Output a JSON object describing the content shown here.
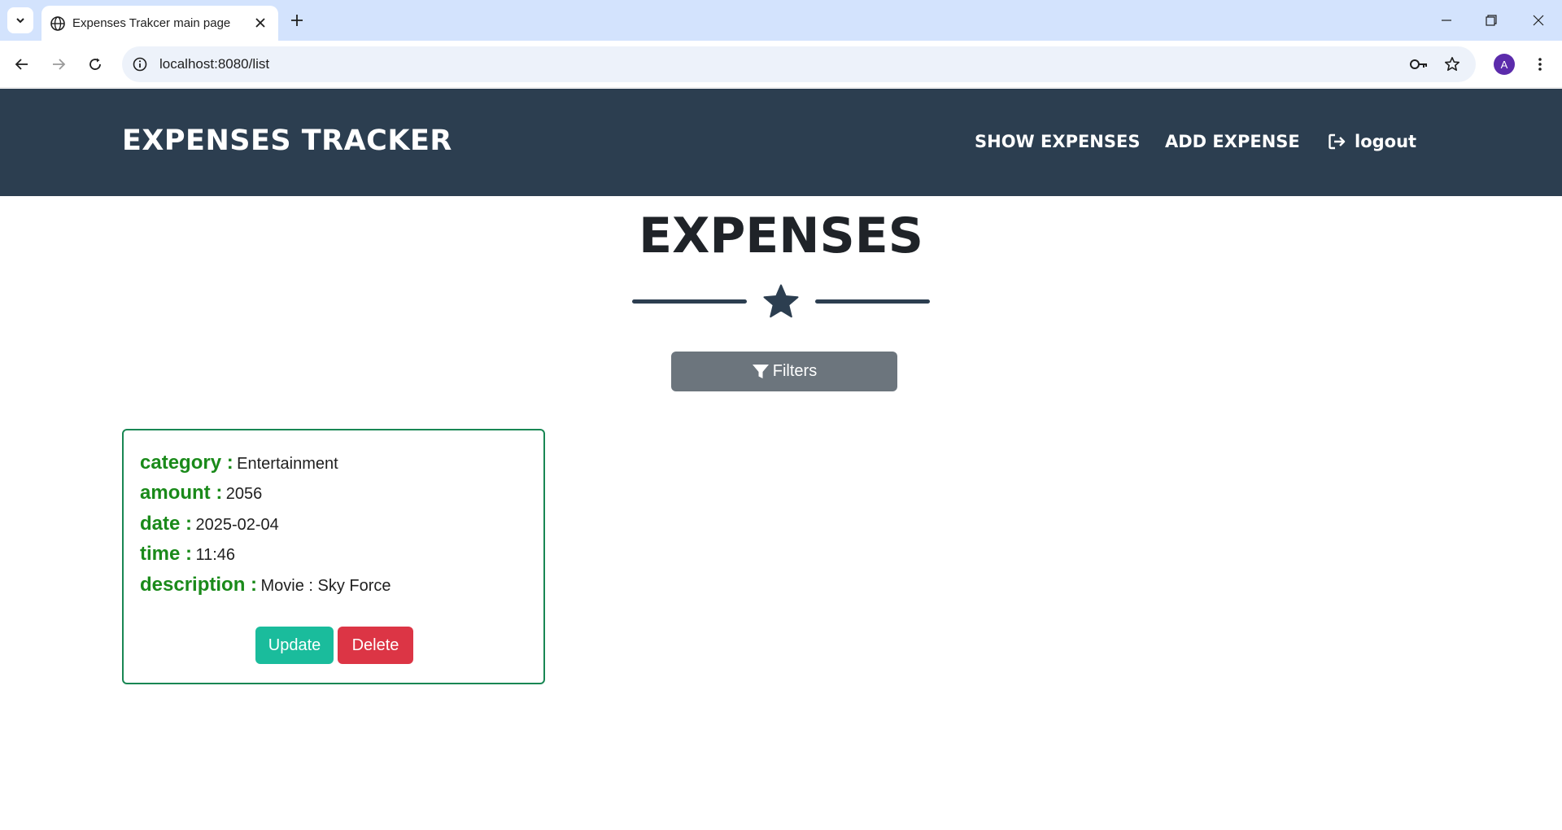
{
  "browser": {
    "tab_title": "Expenses Trakcer main page",
    "url": "localhost:8080/list",
    "profile_initial": "A",
    "icons": [
      "tab-search-icon",
      "globe-icon",
      "close-icon",
      "plus-icon",
      "minimize-icon",
      "restore-icon",
      "window-close-icon",
      "back-icon",
      "forward-icon",
      "reload-icon",
      "info-icon",
      "key-icon",
      "star-icon",
      "more-vert-icon"
    ]
  },
  "nav": {
    "brand": "EXPENSES TRACKER",
    "show_expenses": "SHOW EXPENSES",
    "add_expense": "ADD EXPENSE",
    "logout": "logout"
  },
  "main": {
    "title": "EXPENSES",
    "filters_label": "Filters"
  },
  "expense": {
    "category_label": "category :",
    "category": "Entertainment",
    "amount_label": "amount :",
    "amount": "2056",
    "date_label": "date :",
    "date": "2025-02-04",
    "time_label": "time :",
    "time": "11:46",
    "description_label": "description :",
    "description": "Movie : Sky Force",
    "update_label": "Update",
    "delete_label": "Delete"
  },
  "colors": {
    "nav_bg": "#2c3e50",
    "label_green": "#1a8a1a",
    "card_border": "#198754",
    "update": "#1abc9c",
    "delete": "#dc3545",
    "filters": "#6c757d"
  }
}
